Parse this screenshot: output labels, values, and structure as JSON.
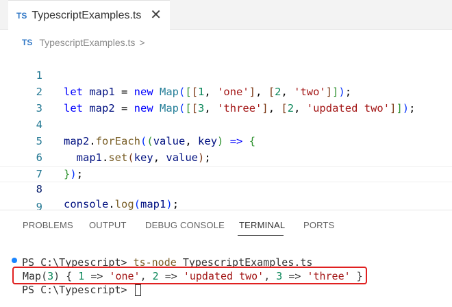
{
  "tab": {
    "badge": "TS",
    "title": "TypescriptExamples.ts",
    "close_icon": "close-icon"
  },
  "breadcrumb": {
    "badge": "TS",
    "file": "TypescriptExamples.ts",
    "chevron": ">"
  },
  "editor": {
    "line_numbers": [
      "1",
      "2",
      "3",
      "4",
      "5",
      "6",
      "7",
      "8",
      "9"
    ],
    "current_line": "8",
    "lines": [
      "let map1 = new Map([[1, 'one'], [2, 'two']]);",
      "let map2 = new Map([[3, 'three'], [2, 'updated two']]);",
      "",
      "map2.forEach((value, key) => {",
      "  map1.set(key, value);",
      "});",
      "",
      "console.log(map1);",
      ""
    ]
  },
  "panel": {
    "tabs": [
      "PROBLEMS",
      "OUTPUT",
      "DEBUG CONSOLE",
      "TERMINAL",
      "PORTS"
    ],
    "active_tab": "TERMINAL"
  },
  "terminal": {
    "prompt": "PS C:\\Typescript>",
    "command": "ts-node",
    "command_arg": "TypescriptExamples.ts",
    "output": "Map(3) { 1 => 'one', 2 => 'updated two', 3 => 'three' }",
    "status_dot_color": "#1a85ff",
    "highlight_color": "#e02020"
  }
}
